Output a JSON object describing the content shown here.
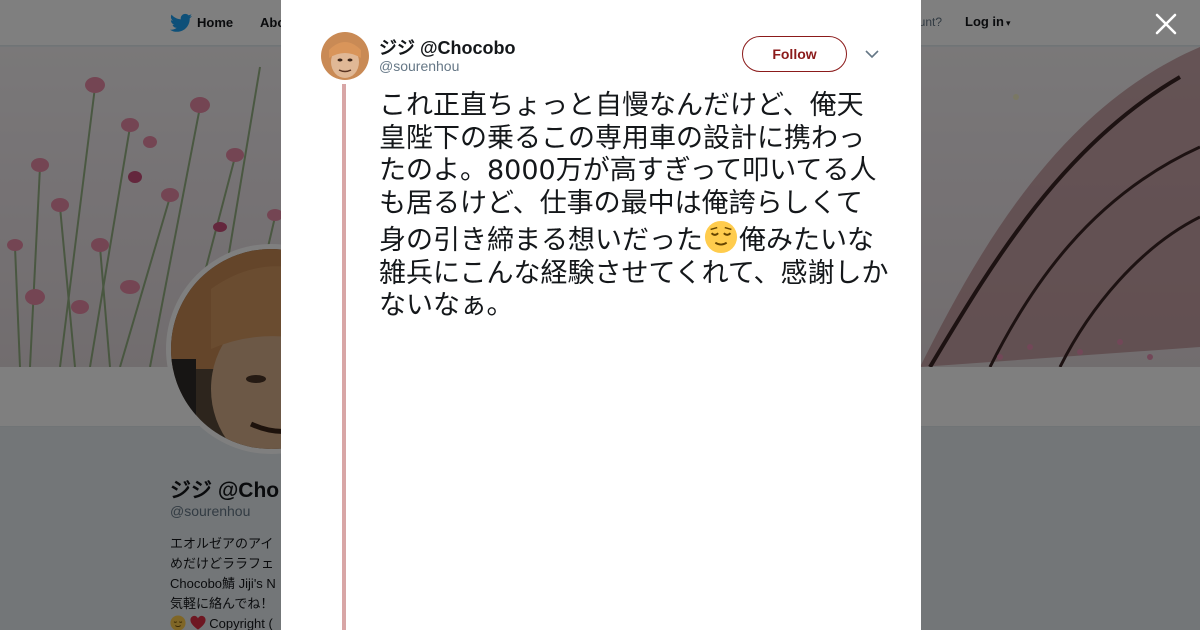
{
  "topbar": {
    "home_label": "Home",
    "about_label": "Abo",
    "account_prompt": "ccount?",
    "login_label": "Log in"
  },
  "profile": {
    "name": "ジジ @Cho",
    "handle": "@sourenhou",
    "bio_lines": [
      "エオルゼアのアイ",
      "めだけどララフェ",
      "Chocobo鯖 Jiji's N",
      "気軽に絡んでね！",
      "Copyright ("
    ]
  },
  "tweet": {
    "author_name": "ジジ @Chocobo",
    "author_handle": "@sourenhou",
    "follow_label": "Follow",
    "text_before_emoji": "これ正直ちょっと自慢なんだけど、俺天皇陛下の乗るこの専用車の設計に携わったのよ。8000万が高すぎって叩いてる人も居るけど、仕事の最中は俺誇らしくて身の引き締まる想いだった",
    "emoji_name": "relieved-face-emoji",
    "text_after_emoji": "俺みたいな雑兵にこんな経験させてくれて、感謝しかないなぁ。"
  },
  "colors": {
    "accent": "#8b1a1a",
    "thread_line": "#d8a6a6",
    "twitter_blue": "#1da1f2",
    "overlay": "rgba(0,0,0,0.5)"
  },
  "icons": {
    "bird": "twitter-bird-icon",
    "close": "close-icon",
    "caret": "chevron-down-icon"
  }
}
